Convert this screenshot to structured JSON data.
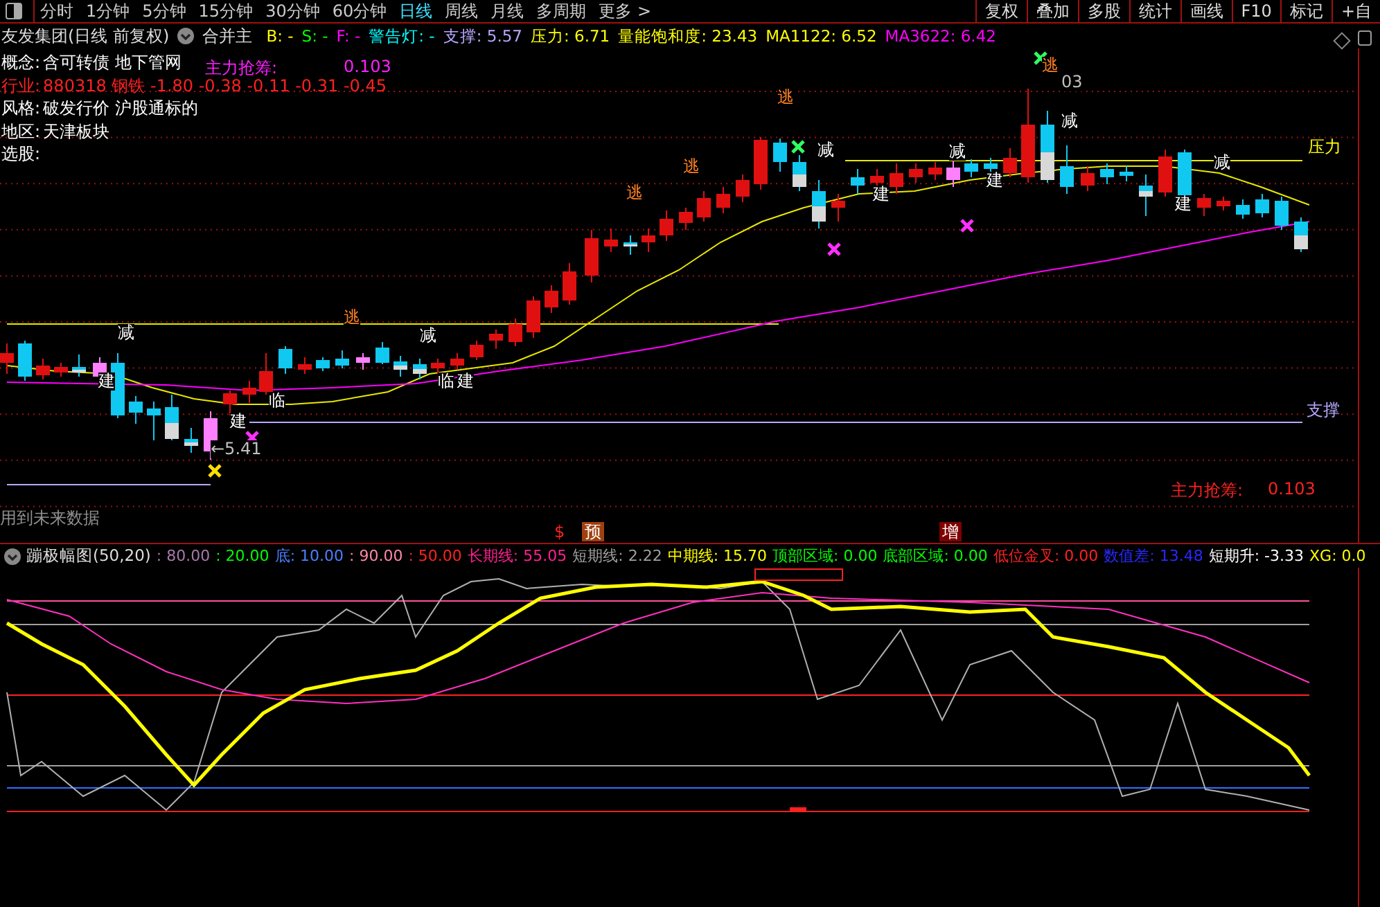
{
  "toolbar": {
    "periods": [
      {
        "label": "分时",
        "selected": false
      },
      {
        "label": "1分钟",
        "selected": false
      },
      {
        "label": "5分钟",
        "selected": false
      },
      {
        "label": "15分钟",
        "selected": false
      },
      {
        "label": "30分钟",
        "selected": false
      },
      {
        "label": "60分钟",
        "selected": false
      },
      {
        "label": "日线",
        "selected": true
      },
      {
        "label": "周线",
        "selected": false
      },
      {
        "label": "月线",
        "selected": false
      },
      {
        "label": "多周期",
        "selected": false
      },
      {
        "label": "更多 >",
        "selected": false
      }
    ],
    "actions": [
      "复权",
      "叠加",
      "多股",
      "统计",
      "画线",
      "F10",
      "标记",
      "+自"
    ]
  },
  "header": {
    "title": "友发集团(日线 前复权)",
    "mode": "合并主",
    "fields": [
      {
        "label": "B:",
        "value": "-",
        "color": "#ffff00"
      },
      {
        "label": "S:",
        "value": "-",
        "color": "#00ff00"
      },
      {
        "label": "F:",
        "value": "-",
        "color": "#ff00ff"
      },
      {
        "label": "警告灯:",
        "value": "-",
        "color": "#00ffff"
      },
      {
        "label": "支撑:",
        "value": "5.57",
        "color": "#b8a8ff"
      },
      {
        "label": "压力:",
        "value": "6.71",
        "color": "#ffff00"
      },
      {
        "label": "量能饱和度:",
        "value": "23.43",
        "color": "#ffff00"
      },
      {
        "label": "MA1122:",
        "value": "6.52",
        "color": "#ffff00"
      },
      {
        "label": "MA3622:",
        "value": "6.42",
        "color": "#ff00ff"
      }
    ]
  },
  "info": [
    {
      "label": "概念:",
      "value": "含可转债 地下管网",
      "kind": "plain"
    },
    {
      "label": "行业:",
      "value": "880318 钢铁 -1.80 -0.38 -0.11 -0.31 -0.45",
      "kind": "alert"
    },
    {
      "label": "风格:",
      "value": "破发行价 沪股通标的",
      "kind": "plain"
    },
    {
      "label": "地区:",
      "value": "天津板块",
      "kind": "plain"
    },
    {
      "label": "选股:",
      "kind": "plain"
    }
  ],
  "overlay_value": {
    "label": "主力抢筹:",
    "value": "0.103"
  },
  "chart_labels": [
    {
      "text": "逃",
      "kind": "escape"
    },
    {
      "text": "逃",
      "kind": "escape"
    },
    {
      "text": "逃",
      "kind": "escape"
    },
    {
      "text": "逃",
      "kind": "escape"
    },
    {
      "text": "逃",
      "kind": "escape"
    },
    {
      "text": "减",
      "kind": "signal"
    },
    {
      "text": "减",
      "kind": "signal"
    },
    {
      "text": "减",
      "kind": "signal"
    },
    {
      "text": "减",
      "kind": "signal"
    },
    {
      "text": "减",
      "kind": "signal"
    },
    {
      "text": "减",
      "kind": "signal"
    },
    {
      "text": "建",
      "kind": "signal"
    },
    {
      "text": "建",
      "kind": "signal"
    },
    {
      "text": "建",
      "kind": "signal"
    },
    {
      "text": "建",
      "kind": "signal"
    },
    {
      "text": "建",
      "kind": "signal"
    },
    {
      "text": "建",
      "kind": "signal"
    },
    {
      "text": "临",
      "kind": "signal"
    },
    {
      "text": "临",
      "kind": "signal"
    },
    {
      "text": "压力",
      "kind": "resistance"
    },
    {
      "text": "支撑",
      "kind": "support"
    },
    {
      "text": "←5.41",
      "kind": "price"
    },
    {
      "text": "03",
      "kind": "price"
    }
  ],
  "main_force": {
    "label": "主力抢筹:",
    "value": "0.103"
  },
  "warning": "用到未来数据",
  "markers": [
    {
      "text": "$",
      "kind": "plain"
    },
    {
      "text": "预",
      "kind": "badge"
    },
    {
      "text": "增",
      "kind": "badge"
    }
  ],
  "indicator": {
    "title": "蹦极幅图(50,20)",
    "fields": [
      {
        "label": ":",
        "value": "80.00",
        "color": "#a878a8"
      },
      {
        "label": ":",
        "value": "20.00",
        "color": "#00ff00"
      },
      {
        "label": "底:",
        "value": "10.00",
        "color": "#4a80ff"
      },
      {
        "label": ":",
        "value": "90.00",
        "color": "#ff88a8"
      },
      {
        "label": ":",
        "value": "50.00",
        "color": "#ff2020"
      },
      {
        "label": "长期线:",
        "value": "55.05",
        "color": "#ff2090"
      },
      {
        "label": "短期线:",
        "value": "2.22",
        "color": "#a0a0a0"
      },
      {
        "label": "中期线:",
        "value": "15.70",
        "color": "#ffff00"
      },
      {
        "label": "顶部区域:",
        "value": "0.00",
        "color": "#00ff00"
      },
      {
        "label": "底部区域:",
        "value": "0.00",
        "color": "#00ff00"
      },
      {
        "label": "低位金叉:",
        "value": "0.00",
        "color": "#ff2020"
      },
      {
        "label": "数值差:",
        "value": "13.48",
        "color": "#2828ff"
      },
      {
        "label": "短期升:",
        "value": "-3.33",
        "color": "#ffffff"
      },
      {
        "label": "XG:",
        "value": "0.0",
        "color": "#ffff00"
      }
    ]
  }
}
